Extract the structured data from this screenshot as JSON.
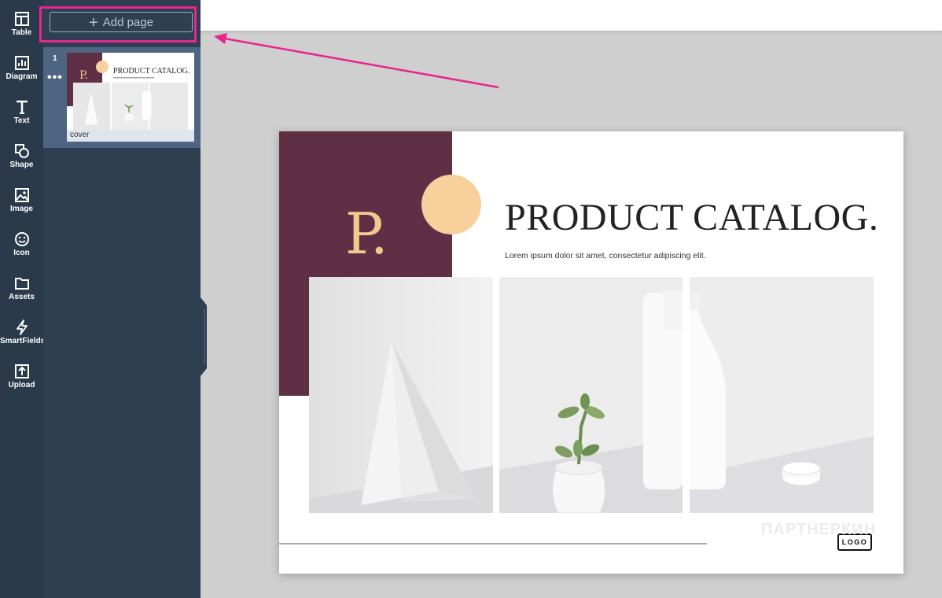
{
  "sidebar": {
    "tools": [
      {
        "label": "Table",
        "icon": "table-icon"
      },
      {
        "label": "Diagram",
        "icon": "diagram-icon"
      },
      {
        "label": "Text",
        "icon": "text-icon"
      },
      {
        "label": "Shape",
        "icon": "shape-icon"
      },
      {
        "label": "Image",
        "icon": "image-icon"
      },
      {
        "label": "Icon",
        "icon": "smiley-icon"
      },
      {
        "label": "Assets",
        "icon": "folder-icon"
      },
      {
        "label": "SmartFields",
        "icon": "lightning-icon"
      },
      {
        "label": "Upload",
        "icon": "upload-icon"
      }
    ]
  },
  "pages_panel": {
    "add_page_label": "Add page",
    "pages": [
      {
        "number": "1",
        "name": "cover"
      }
    ]
  },
  "document": {
    "monogram": "P.",
    "title": "PRODUCT CATALOG.",
    "subtitle": "Lorem ipsum dolor sit amet, consectetur adipiscing elit.",
    "logo": "LOGO"
  },
  "watermark": "ПАРТНЕРКИН",
  "colors": {
    "annotation": "#e8268f",
    "maroon": "#5e2f45",
    "peach": "#f7d09c",
    "sidebar": "#2b3a4a",
    "panel": "#2e3f52"
  }
}
